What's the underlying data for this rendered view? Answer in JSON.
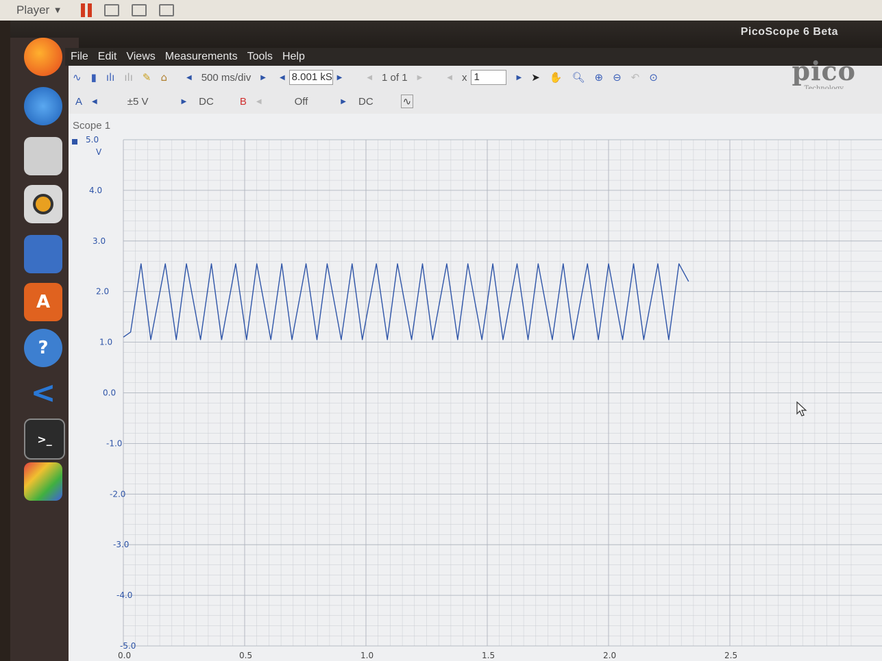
{
  "player": {
    "label": "Player"
  },
  "window": {
    "title": "PicoScope 6 Beta"
  },
  "menu": [
    "File",
    "Edit",
    "Views",
    "Measurements",
    "Tools",
    "Help"
  ],
  "toolbar1": {
    "timebase": "500 ms/div",
    "samples": "8.001 kS",
    "capture_index": "1 of 1",
    "zoom_x_label": "x",
    "zoom_x_value": "1"
  },
  "toolbar2": {
    "channel_a": "A",
    "range_a": "±5 V",
    "coupling_a": "DC",
    "channel_b": "B",
    "range_b": "Off",
    "coupling_b": "DC"
  },
  "logo": {
    "text": "pico",
    "subtext": "Technology"
  },
  "scope": {
    "title": "Scope 1",
    "unit": "V"
  },
  "colors": {
    "trace": "#2f55a8",
    "grid": "#c9ccd2",
    "background": "#eff0f2"
  },
  "chart_data": {
    "type": "line",
    "ylabel": "V",
    "ylim": [
      -5.0,
      5.0
    ],
    "yticks": [
      "5.0",
      "4.0",
      "3.0",
      "2.0",
      "1.0",
      "0.0",
      "-1.0",
      "-2.0",
      "-3.0",
      "-4.0",
      "-5.0"
    ],
    "xticks": [
      "0.0",
      "0.5",
      "1.0",
      "1.5",
      "2.0",
      "2.5"
    ],
    "series": [
      {
        "x": [
          0.0,
          0.03,
          0.073,
          0.113,
          0.173,
          0.218,
          0.26,
          0.318,
          0.363,
          0.405,
          0.463,
          0.508,
          0.55,
          0.608,
          0.653,
          0.695,
          0.753,
          0.798,
          0.84,
          0.898,
          0.943,
          0.985,
          1.043,
          1.088,
          1.13,
          1.188,
          1.233,
          1.275,
          1.333,
          1.378,
          1.42,
          1.478,
          1.523,
          1.565,
          1.623,
          1.668,
          1.71,
          1.768,
          1.813,
          1.855,
          1.913,
          1.958,
          2.0,
          2.058,
          2.103,
          2.145,
          2.203,
          2.248,
          2.29,
          2.33
        ],
        "y": [
          1.1,
          1.2,
          2.55,
          1.05,
          2.55,
          1.05,
          2.55,
          1.05,
          2.55,
          1.05,
          2.55,
          1.05,
          2.55,
          1.05,
          2.55,
          1.05,
          2.55,
          1.05,
          2.55,
          1.05,
          2.55,
          1.05,
          2.55,
          1.05,
          2.55,
          1.05,
          2.55,
          1.05,
          2.55,
          1.05,
          2.55,
          1.05,
          2.55,
          1.05,
          2.55,
          1.05,
          2.55,
          1.05,
          2.55,
          1.05,
          2.55,
          1.05,
          2.55,
          1.05,
          2.55,
          1.05,
          2.55,
          1.05,
          2.55,
          2.2
        ]
      }
    ]
  }
}
